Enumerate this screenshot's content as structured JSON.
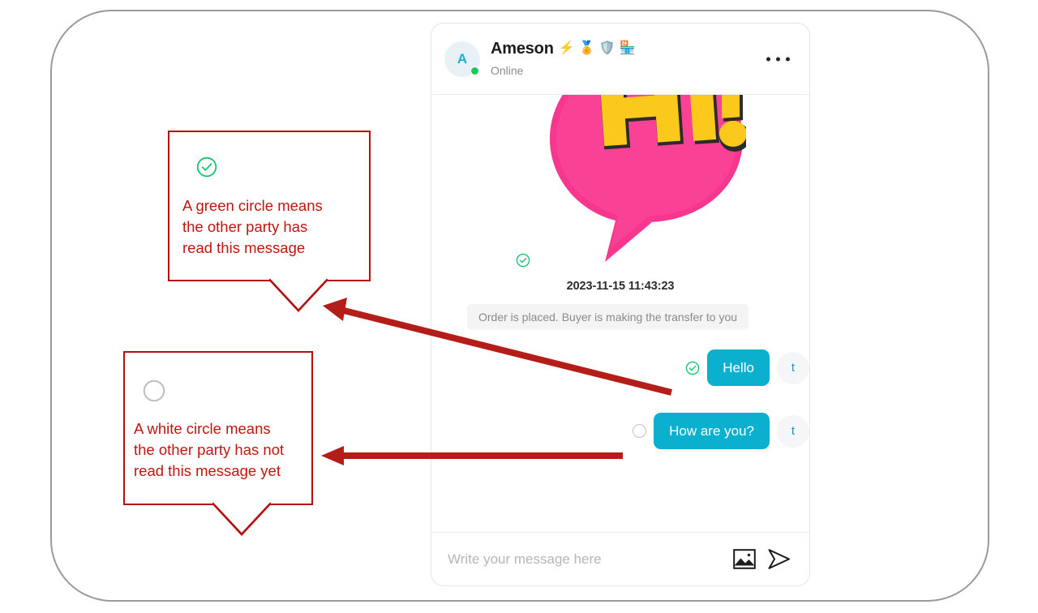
{
  "chat": {
    "header": {
      "avatar_initial": "A",
      "contact_name": "Ameson",
      "status": "Online",
      "badges": [
        "lightning-badge",
        "medal-badge",
        "shield-verified-badge",
        "store-badge"
      ],
      "more_menu": "more-options"
    },
    "messages": [
      {
        "type": "sticker",
        "name": "hi-sticker",
        "sticker_text": "HI!",
        "receipt": "read",
        "direction": "incoming-sticker"
      },
      {
        "type": "timestamp",
        "text": "2023-11-15 11:43:23"
      },
      {
        "type": "system",
        "text": "Order is placed. Buyer is making the transfer to you"
      },
      {
        "type": "outgoing",
        "text": "Hello",
        "receipt": "read",
        "avatar_initial": "t"
      },
      {
        "type": "outgoing",
        "text": "How are you?",
        "receipt": "unread",
        "avatar_initial": "t"
      }
    ],
    "composer": {
      "placeholder": "Write your message here",
      "value": "",
      "image_button": "image-attachment",
      "send_button": "send-message"
    }
  },
  "annotations": [
    {
      "id": "green-circle-callout",
      "icon": "green-check-circle-icon",
      "text": "A green circle means\nthe other party has\nread this message"
    },
    {
      "id": "white-circle-callout",
      "icon": "white-empty-circle-icon",
      "text": "A white circle means\nthe other party has not\nread this message yet"
    }
  ],
  "colors": {
    "annotation_red": "#b41010",
    "annotation_text_red": "#c0160f",
    "bubble_cyan": "#0bb0ce",
    "read_green": "#13c56e",
    "unread_gray": "#c2c2c2",
    "online_green": "#16c95b",
    "sticker_pink": "#f7368f",
    "sticker_yellow": "#fbc91b"
  }
}
